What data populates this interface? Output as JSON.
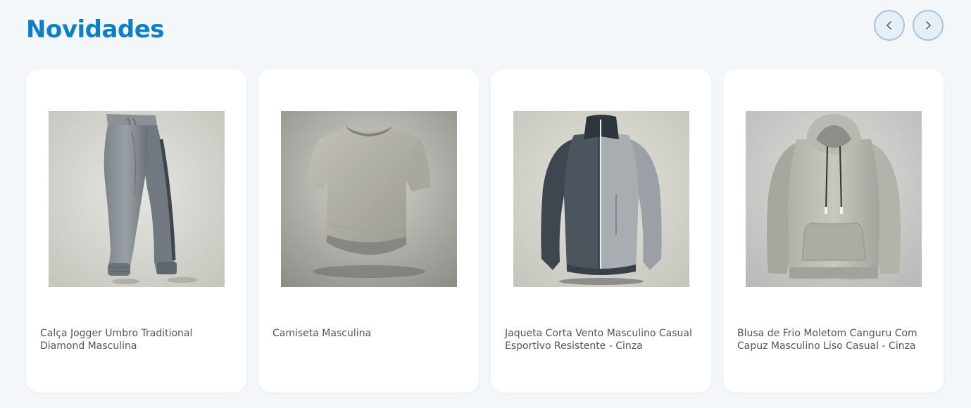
{
  "section": {
    "title": "Novidades"
  },
  "carousel": {
    "prev_icon": "chevron-left-icon",
    "next_icon": "chevron-right-icon",
    "accent_color": "#0d7fc6"
  },
  "products": [
    {
      "name": "Calça Jogger Umbro Traditional Diamond Masculina",
      "image": "jogger-pants-image"
    },
    {
      "name": "Camiseta Masculina",
      "image": "tshirt-image"
    },
    {
      "name": "Jaqueta Corta Vento Masculino Casual Esportivo Resistente - Cinza",
      "image": "zip-jacket-image"
    },
    {
      "name": "Blusa de Frio Moletom Canguru Com Capuz Masculino Liso Casual - Cinza",
      "image": "hoodie-image"
    }
  ]
}
